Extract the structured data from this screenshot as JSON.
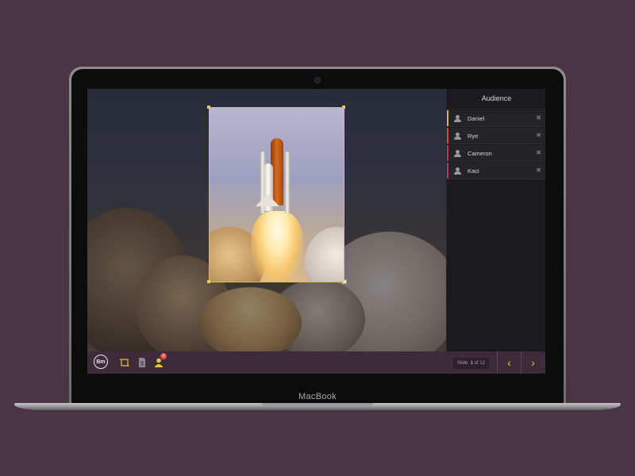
{
  "device": {
    "brand": "MacBook"
  },
  "sidebar": {
    "title": "Audience",
    "people": [
      {
        "name": "Daniel",
        "color": "#d6b93a"
      },
      {
        "name": "Rye",
        "color": "#c9503a"
      },
      {
        "name": "Cameron",
        "color": "#b73a55"
      },
      {
        "name": "Kaci",
        "color": "#a73e74"
      }
    ],
    "remove_glyph": "✖"
  },
  "toolbar": {
    "logo_text": "Bm",
    "tools": [
      "crop-tool-icon",
      "document-icon",
      "audience-icon"
    ],
    "audience_badge": "4",
    "slide_label": "Slide",
    "slide_current": "1",
    "slide_of": "of",
    "slide_total": "12",
    "prev_glyph": "‹",
    "next_glyph": "›"
  },
  "colors": {
    "accent": "#e5c83a",
    "toolbar": "#3e2b3a",
    "sidebar": "#1b1a1e"
  }
}
